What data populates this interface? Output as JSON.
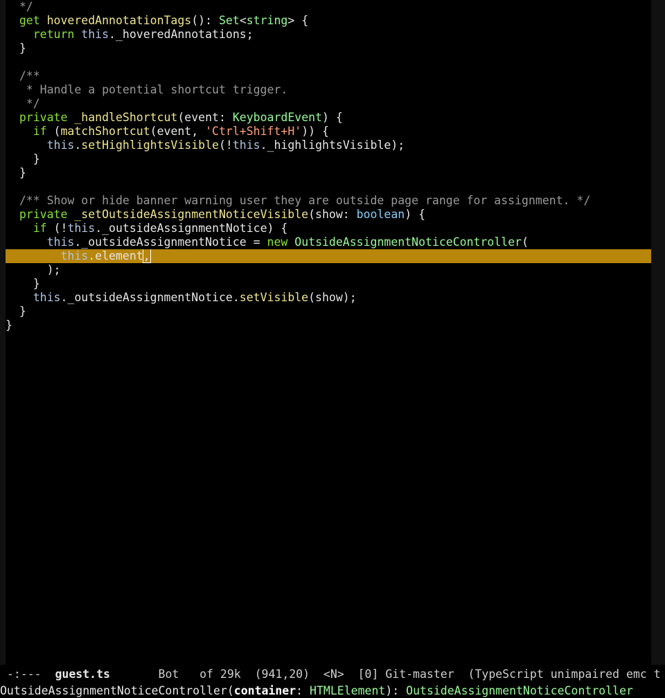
{
  "editor": {
    "lines": [
      [
        {
          "t": "  */",
          "c": "comment"
        }
      ],
      [
        {
          "t": "  ",
          "c": "plain"
        },
        {
          "t": "get",
          "c": "kw"
        },
        {
          "t": " ",
          "c": "plain"
        },
        {
          "t": "hoveredAnnotationTags",
          "c": "fn"
        },
        {
          "t": "(): ",
          "c": "plain"
        },
        {
          "t": "Set",
          "c": "type"
        },
        {
          "t": "<",
          "c": "plain"
        },
        {
          "t": "string",
          "c": "type"
        },
        {
          "t": "> {",
          "c": "plain"
        }
      ],
      [
        {
          "t": "    ",
          "c": "plain"
        },
        {
          "t": "return",
          "c": "kw"
        },
        {
          "t": " ",
          "c": "plain"
        },
        {
          "t": "this",
          "c": "this"
        },
        {
          "t": "._hoveredAnnotations;",
          "c": "plain"
        }
      ],
      [
        {
          "t": "  }",
          "c": "plain"
        }
      ],
      [
        {
          "t": "",
          "c": "plain"
        }
      ],
      [
        {
          "t": "  /**",
          "c": "comment"
        }
      ],
      [
        {
          "t": "   * Handle a potential shortcut trigger.",
          "c": "comment"
        }
      ],
      [
        {
          "t": "   */",
          "c": "comment"
        }
      ],
      [
        {
          "t": "  ",
          "c": "plain"
        },
        {
          "t": "private",
          "c": "kw"
        },
        {
          "t": " ",
          "c": "plain"
        },
        {
          "t": "_handleShortcut",
          "c": "fn"
        },
        {
          "t": "(event: ",
          "c": "plain"
        },
        {
          "t": "KeyboardEvent",
          "c": "type"
        },
        {
          "t": ") {",
          "c": "plain"
        }
      ],
      [
        {
          "t": "    ",
          "c": "plain"
        },
        {
          "t": "if",
          "c": "kw"
        },
        {
          "t": " (",
          "c": "plain"
        },
        {
          "t": "matchShortcut",
          "c": "fn"
        },
        {
          "t": "(event, ",
          "c": "plain"
        },
        {
          "t": "'Ctrl+Shift+H'",
          "c": "str"
        },
        {
          "t": ")) {",
          "c": "plain"
        }
      ],
      [
        {
          "t": "      ",
          "c": "plain"
        },
        {
          "t": "this",
          "c": "this"
        },
        {
          "t": ".",
          "c": "plain"
        },
        {
          "t": "setHighlightsVisible",
          "c": "fn"
        },
        {
          "t": "(!",
          "c": "plain"
        },
        {
          "t": "this",
          "c": "this"
        },
        {
          "t": "._highlightsVisible);",
          "c": "plain"
        }
      ],
      [
        {
          "t": "    }",
          "c": "plain"
        }
      ],
      [
        {
          "t": "  }",
          "c": "plain"
        }
      ],
      [
        {
          "t": "",
          "c": "plain"
        }
      ],
      [
        {
          "t": "  /** Show or hide banner warning user they are outside page range for assignment. */",
          "c": "comment"
        }
      ],
      [
        {
          "t": "  ",
          "c": "plain"
        },
        {
          "t": "private",
          "c": "kw"
        },
        {
          "t": " ",
          "c": "plain"
        },
        {
          "t": "_setOutsideAssignmentNoticeVisible",
          "c": "fn"
        },
        {
          "t": "(show: ",
          "c": "plain"
        },
        {
          "t": "boolean",
          "c": "boolty"
        },
        {
          "t": ") {",
          "c": "plain"
        }
      ],
      [
        {
          "t": "    ",
          "c": "plain"
        },
        {
          "t": "if",
          "c": "kw"
        },
        {
          "t": " (!",
          "c": "plain"
        },
        {
          "t": "this",
          "c": "this"
        },
        {
          "t": "._outsideAssignmentNotice) {",
          "c": "plain"
        }
      ],
      [
        {
          "t": "      ",
          "c": "plain"
        },
        {
          "t": "this",
          "c": "this"
        },
        {
          "t": "._outsideAssignmentNotice = ",
          "c": "plain"
        },
        {
          "t": "new",
          "c": "kw"
        },
        {
          "t": " ",
          "c": "plain"
        },
        {
          "t": "OutsideAssignmentNoticeController",
          "c": "type"
        },
        {
          "t": "(",
          "c": "plain"
        }
      ],
      [
        {
          "t": "        ",
          "c": "plain"
        },
        {
          "t": "this",
          "c": "this"
        },
        {
          "t": ".element",
          "c": "plain"
        },
        {
          "t": ",",
          "c": "cursor"
        }
      ],
      [
        {
          "t": "      );",
          "c": "plain"
        }
      ],
      [
        {
          "t": "    }",
          "c": "plain"
        }
      ],
      [
        {
          "t": "    ",
          "c": "plain"
        },
        {
          "t": "this",
          "c": "this"
        },
        {
          "t": "._outsideAssignmentNotice.",
          "c": "plain"
        },
        {
          "t": "setVisible",
          "c": "fn"
        },
        {
          "t": "(show);",
          "c": "plain"
        }
      ],
      [
        {
          "t": "  }",
          "c": "plain"
        }
      ],
      [
        {
          "t": "}",
          "c": "plain"
        }
      ]
    ],
    "current_line_index": 18
  },
  "modeline": {
    "status": " -:---  ",
    "buffer_name": "guest.ts",
    "position": "       Bot   of 29k  (941,20)  <N>  [0] Git-master  (TypeScript unimpaired emc t"
  },
  "echo_area": {
    "func": "OutsideAssignmentNoticeController(",
    "param": "container",
    "sep": ": ",
    "param_type": "HTMLElement",
    "ret": "): ",
    "ret_type": "OutsideAssignmentNoticeController"
  }
}
